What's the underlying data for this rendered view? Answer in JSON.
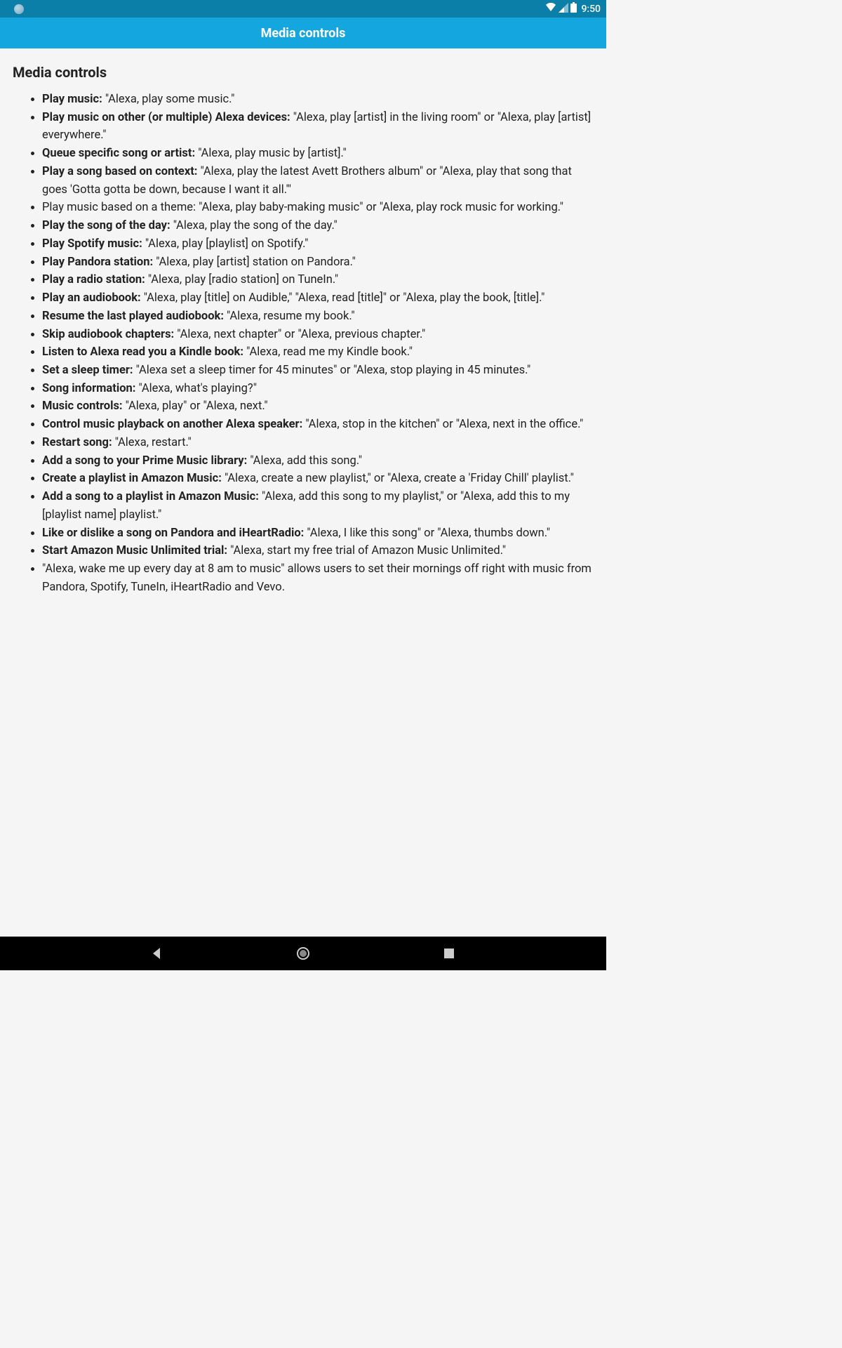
{
  "status": {
    "time": "9:50"
  },
  "appbar": {
    "title": "Media controls"
  },
  "page": {
    "heading": "Media controls"
  },
  "commands": [
    {
      "label": "Play music:",
      "text": " \"Alexa, play some music.\""
    },
    {
      "label": "Play music on other (or multiple) Alexa devices:",
      "text": " \"Alexa, play [artist] in the living room\" or \"Alexa, play [artist] everywhere.\""
    },
    {
      "label": "Queue specific song or artist:",
      "text": " \"Alexa, play music by [artist].\""
    },
    {
      "label": "Play a song based on context:",
      "text": " \"Alexa, play the latest Avett Brothers album\" or \"Alexa, play that song that goes 'Gotta gotta be down, because I want it all.'\""
    },
    {
      "label": "",
      "text": "Play music based on a theme: \"Alexa, play baby-making music\" or \"Alexa, play rock music for working.\""
    },
    {
      "label": "Play the song of the day:",
      "text": " \"Alexa, play the song of the day.\""
    },
    {
      "label": "Play Spotify music:",
      "text": " \"Alexa, play [playlist] on Spotify.\""
    },
    {
      "label": "Play Pandora station:",
      "text": " \"Alexa, play [artist] station on Pandora.\""
    },
    {
      "label": "Play a radio station:",
      "text": " \"Alexa, play [radio station] on TuneIn.\""
    },
    {
      "label": "Play an audiobook:",
      "text": " \"Alexa, play [title] on Audible,\" \"Alexa, read [title]\" or \"Alexa, play the book, [title].\""
    },
    {
      "label": "Resume the last played audiobook:",
      "text": " \"Alexa, resume my book.\""
    },
    {
      "label": "Skip audiobook chapters:",
      "text": " \"Alexa, next chapter\" or \"Alexa, previous chapter.\""
    },
    {
      "label": "Listen to Alexa read you a Kindle book:",
      "text": " \"Alexa, read me my Kindle book.\""
    },
    {
      "label": "Set a sleep timer:",
      "text": " \"Alexa set a sleep timer for 45 minutes\" or \"Alexa, stop playing in 45 minutes.\""
    },
    {
      "label": "Song information:",
      "text": " \"Alexa, what's playing?\""
    },
    {
      "label": "Music controls:",
      "text": " \"Alexa, play\" or \"Alexa, next.\""
    },
    {
      "label": "Control music playback on another Alexa speaker:",
      "text": " \"Alexa, stop in the kitchen\" or \"Alexa, next in the office.\""
    },
    {
      "label": "Restart song:",
      "text": " \"Alexa, restart.\""
    },
    {
      "label": "Add a song to your Prime Music library:",
      "text": " \"Alexa, add this song.\""
    },
    {
      "label": "Create a playlist in Amazon Music:",
      "text": " \"Alexa, create a new playlist,\" or \"Alexa, create a 'Friday Chill' playlist.\""
    },
    {
      "label": "Add a song to a playlist in Amazon Music:",
      "text": " \"Alexa, add this song to my playlist,\" or \"Alexa, add this to my [playlist name] playlist.\""
    },
    {
      "label": "Like or dislike a song on Pandora and iHeartRadio:",
      "text": " \"Alexa, I like this song\" or \"Alexa, thumbs down.\""
    },
    {
      "label": "Start Amazon Music Unlimited trial:",
      "text": " \"Alexa, start my free trial of Amazon Music Unlimited.\""
    },
    {
      "label": "",
      "text": "\"Alexa, wake me up every day at 8 am to music\" allows users to set their mornings off right with music from Pandora, Spotify, TuneIn, iHeartRadio and Vevo."
    }
  ]
}
